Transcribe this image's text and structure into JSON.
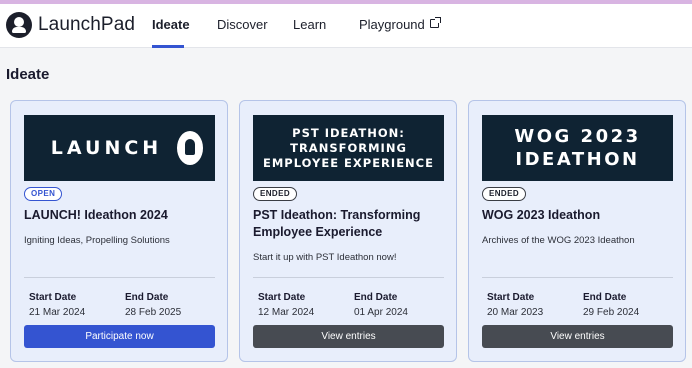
{
  "app": {
    "name": "LaunchPad"
  },
  "nav": {
    "items": [
      {
        "label": "Ideate"
      },
      {
        "label": "Discover"
      },
      {
        "label": "Learn"
      },
      {
        "label": "Playground"
      }
    ],
    "active": "Ideate",
    "external_icon": "external-link-icon"
  },
  "page": {
    "title": "Ideate"
  },
  "colors": {
    "accent": "#3454d1",
    "card_bg": "#e8eefb",
    "banner_bg": "#0f2333",
    "secondary_button": "#474b52"
  },
  "cards": [
    {
      "banner_text": "LAUNCH",
      "banner_icon": "rocket-icon",
      "status": "OPEN",
      "title": "LAUNCH! Ideathon 2024",
      "description": "Igniting Ideas, Propelling Solutions",
      "start_label": "Start Date",
      "start_date": "21 Mar 2024",
      "end_label": "End Date",
      "end_date": "28 Feb 2025",
      "button_label": "Participate now"
    },
    {
      "banner_text": "PST IDEATHON: TRANSFORMING EMPLOYEE EXPERIENCE",
      "status": "ENDED",
      "title": "PST Ideathon: Transforming Employee Experience",
      "description": "Start it up with PST Ideathon now!",
      "start_label": "Start Date",
      "start_date": "12 Mar 2024",
      "end_label": "End Date",
      "end_date": "01 Apr 2024",
      "button_label": "View entries"
    },
    {
      "banner_text": "WOG 2023 IDEATHON",
      "status": "ENDED",
      "title": "WOG 2023 Ideathon",
      "description": "Archives of the WOG 2023 Ideathon",
      "start_label": "Start Date",
      "start_date": "20 Mar 2023",
      "end_label": "End Date",
      "end_date": "29 Feb 2024",
      "button_label": "View entries"
    }
  ]
}
